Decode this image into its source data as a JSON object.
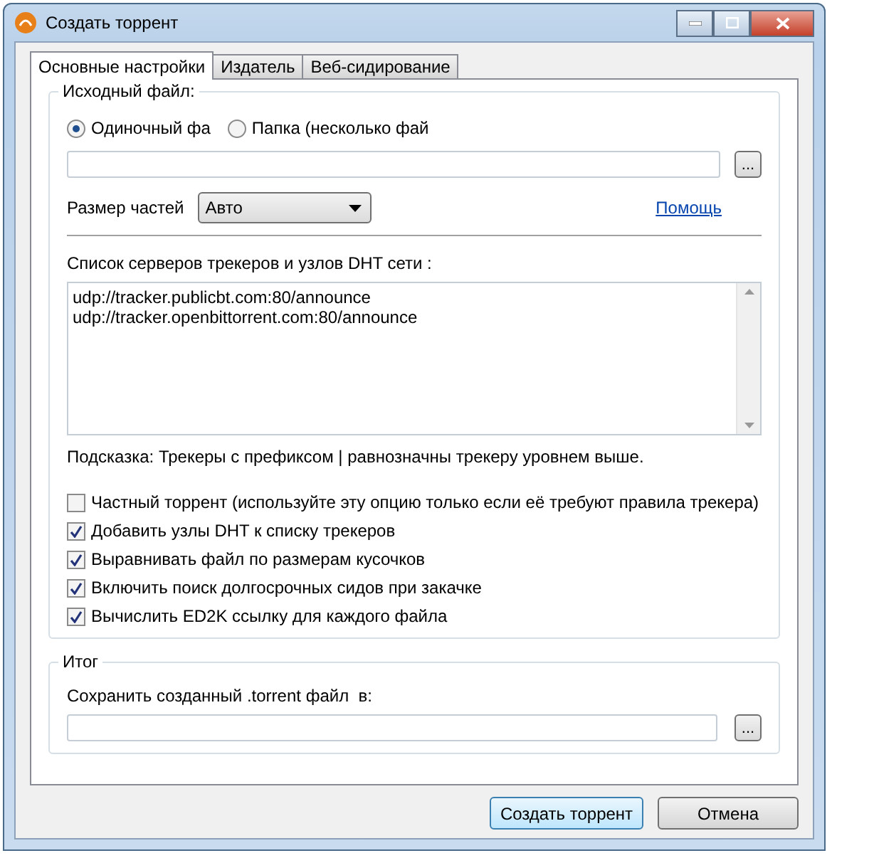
{
  "window": {
    "title": "Создать торрент"
  },
  "tabs": [
    {
      "label": "Основные настройки",
      "selected": true
    },
    {
      "label": "Издатель",
      "selected": false
    },
    {
      "label": "Веб-сидирование",
      "selected": false
    }
  ],
  "source": {
    "title": "Исходный файл:",
    "options": [
      {
        "label": "Одиночный фа",
        "selected": true
      },
      {
        "label": "Папка (несколько фай",
        "selected": false
      }
    ],
    "browse": "...",
    "piece_size": {
      "label": "Размер частей",
      "value": "Авто"
    },
    "help_link": "Помощь"
  },
  "trackers": {
    "label": "Список серверов трекеров и узлов DHT сети :",
    "lines": [
      "udp://tracker.publicbt.com:80/announce",
      "udp://tracker.openbittorrent.com:80/announce"
    ],
    "hint": "Подсказка: Трекеры с префиксом | равнозначны трекеру уровнем выше."
  },
  "options": [
    {
      "label": "Частный торрент (используйте эту опцию только если её требуют правила трекера)",
      "checked": false
    },
    {
      "label": "Добавить узлы DHT к списку трекеров",
      "checked": true
    },
    {
      "label": "Выравнивать файл по размерам кусочков",
      "checked": true
    },
    {
      "label": "Включить поиск долгосрочных сидов при закачке",
      "checked": true
    },
    {
      "label": "Вычислить ED2K ссылку для каждого файла",
      "checked": true
    }
  ],
  "result": {
    "title": "Итог",
    "label": "Сохранить созданный .torrent файл  в:",
    "browse": "..."
  },
  "buttons": [
    {
      "label": "Создать торрент",
      "kind": "default"
    },
    {
      "label": "Отмена",
      "kind": "normal"
    }
  ]
}
